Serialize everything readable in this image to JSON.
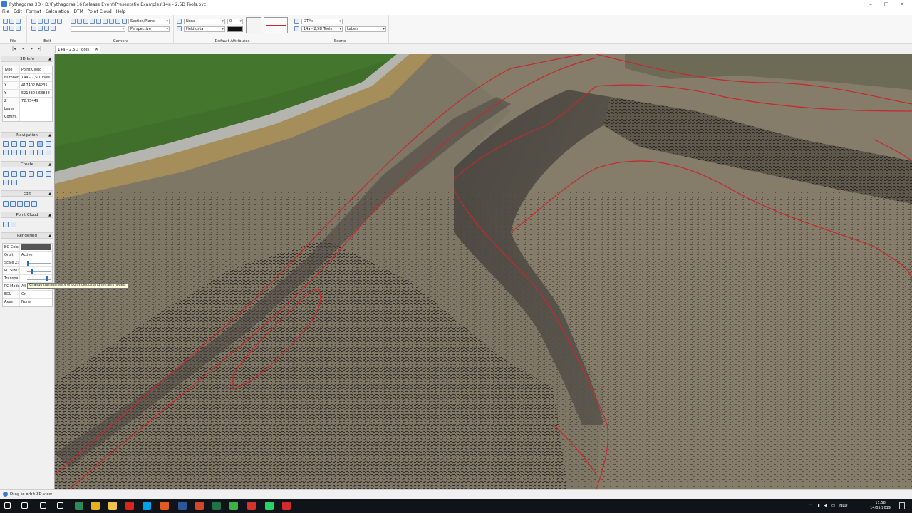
{
  "window": {
    "title": "Pythagoras 3D - D:\\Pythagoras 16 Release Event\\Presentatie Examples\\14a - 2,5D Tools.pyc",
    "controls": [
      "–",
      "□",
      "✕"
    ]
  },
  "menu": [
    "File",
    "Edit",
    "Format",
    "Calculation",
    "DTM",
    "Point Cloud",
    "Help"
  ],
  "ribbon": {
    "groups": [
      "File",
      "Edit",
      "Camera",
      "Default Attributes",
      "Scene"
    ],
    "camera": {
      "section_combo": "Section/Plane",
      "projection_combo": "Perspective"
    },
    "attributes": {
      "linetype_combo": "None",
      "width_combo": "0",
      "field_combo": "Field data"
    },
    "scene": {
      "dtm_combo": "DTMs",
      "scene_combo": "14a - 2,5D Tools",
      "labels_combo": "Labels"
    }
  },
  "tabs": {
    "active": "14a - 2,5D Tools",
    "close": "✕",
    "nav": [
      "|◂",
      "◂",
      "▸",
      "▸|"
    ]
  },
  "side_panel": {
    "info_title": "3D Info",
    "info": [
      {
        "k": "Type",
        "v": "Point Cloud"
      },
      {
        "k": "Number",
        "v": "14a - 2,5D Tools"
      },
      {
        "k": "X",
        "v": "417402.84235"
      },
      {
        "k": "Y",
        "v": "5218304.68838"
      },
      {
        "k": "Z",
        "v": "72.75449"
      },
      {
        "k": "Layer",
        "v": ""
      },
      {
        "k": "Comm.",
        "v": ""
      }
    ],
    "navigation_title": "Navigation",
    "create_title": "Create",
    "edit_title": "Edit",
    "pointcloud_title": "Point Cloud",
    "rendering_title": "Rendering",
    "rendering": [
      {
        "k": "BG Color",
        "v": ""
      },
      {
        "k": "Orbit",
        "v": "Active"
      },
      {
        "k": "Scale Z:",
        "v": ""
      },
      {
        "k": "PC Size:",
        "v": ""
      },
      {
        "k": "Transpa...",
        "v": ""
      },
      {
        "k": "PC Mode",
        "v": "All"
      },
      {
        "k": "EDL",
        "v": "On"
      },
      {
        "k": "Axes",
        "v": "None"
      }
    ],
    "tooltip": "Change transparency of point clouds and terrain models"
  },
  "status": {
    "text": "Drag to orbit 3D view"
  },
  "taskbar": {
    "lang": "NLD",
    "time": "11:58",
    "date": "14/05/2019",
    "apps": [
      {
        "name": "start",
        "color": "#ffffff"
      },
      {
        "name": "search",
        "color": "#ffffff"
      },
      {
        "name": "calendar",
        "color": "#ffffff"
      },
      {
        "name": "mail",
        "color": "#ffffff"
      },
      {
        "name": "pythagoras",
        "color": "#2e8b57"
      },
      {
        "name": "chrome",
        "color": "#e8b21a"
      },
      {
        "name": "explorer",
        "color": "#f0c24b"
      },
      {
        "name": "acrobat",
        "color": "#d9261c"
      },
      {
        "name": "skype",
        "color": "#00a2e8"
      },
      {
        "name": "firefox",
        "color": "#e45a1f"
      },
      {
        "name": "word",
        "color": "#2b579a"
      },
      {
        "name": "powerpoint",
        "color": "#d24726"
      },
      {
        "name": "excel",
        "color": "#217346"
      },
      {
        "name": "camtasia",
        "color": "#3cb043"
      },
      {
        "name": "snagit",
        "color": "#d6332b"
      },
      {
        "name": "whatsapp",
        "color": "#25d366"
      },
      {
        "name": "codi",
        "color": "#d12b2b"
      }
    ]
  },
  "colors": {
    "contour": "#c8282d",
    "grass": "#3f6f2a",
    "terrain": "#7b7463",
    "road": "#b5b5b0"
  }
}
